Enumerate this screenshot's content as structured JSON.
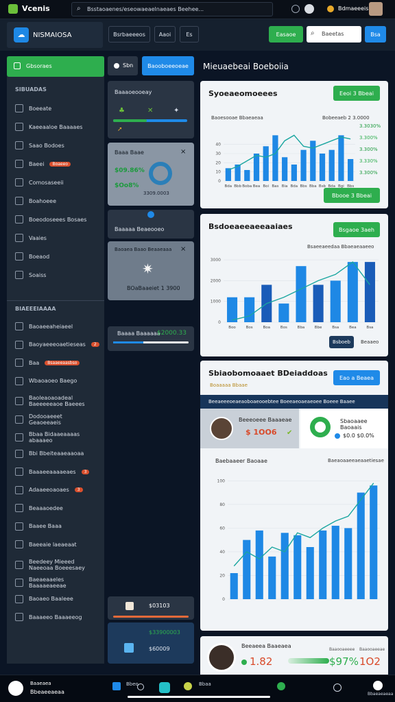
{
  "topbar": {
    "app_name": "Vcenis",
    "search_text": "Bsstaoaenes/eseowaeaelnaeaes Beehee...",
    "user_name": "Bdmaeeeis"
  },
  "navbar": {
    "brand": "NISMAIOSA",
    "btn1": "Bsrbaeeeos",
    "btn2": "Aaoi",
    "btn3": "Es",
    "green_btn": "Easaoe",
    "search_placeholder": "Baeetas",
    "blue_btn": "Bsa"
  },
  "sidebar": {
    "active_item": "Gbsoraes",
    "section1": "SIBUADAS",
    "items1": [
      {
        "icon": "list-icon",
        "label": "Boeeate"
      },
      {
        "icon": "folder-icon",
        "label": "Kaeeaaloe Baaaaes"
      },
      {
        "icon": "grid-icon",
        "label": "Saao Bodoes"
      },
      {
        "icon": "file-icon",
        "label": "Baeei",
        "badge": "Boaeeo"
      },
      {
        "icon": "box-icon",
        "label": "Comosaseeii"
      },
      {
        "icon": "pen-icon",
        "label": "Boahoeee"
      },
      {
        "icon": "gear-icon",
        "label": "Boeodoseees Bosaes"
      },
      {
        "icon": "window-icon",
        "label": "Vaaies"
      },
      {
        "icon": "doc-icon",
        "label": "Boeaod"
      },
      {
        "icon": "mail-icon",
        "label": "Soaiss"
      }
    ],
    "section2": "BIAEEEIAAAA",
    "items2": [
      {
        "icon": "people-icon",
        "label": "Baoaeeaheiaeel"
      },
      {
        "icon": "chart-icon",
        "label": "Baoyaeeeoaetieseas",
        "badge": "2"
      },
      {
        "icon": "cube-icon",
        "label": "Baa",
        "badge": "Bsaaeeaasbso"
      },
      {
        "icon": "clock-icon",
        "label": "Wbaoaoeo Baego"
      },
      {
        "icon": "globe-icon",
        "label": "Baoleaoaoadeal Baeeeeeaoe Baeees"
      },
      {
        "icon": "book-icon",
        "label": "Dodooaeeet Geaoeeaeis"
      },
      {
        "icon": "screen-icon",
        "label": "Bbaa Bidaaeaaaas abaaaeo"
      },
      {
        "icon": "image-icon",
        "label": "Bbi Bbeiteaaeaaoaa"
      },
      {
        "icon": "monitor-icon",
        "label": "Baaaeeaaaaeaes",
        "badge": "3"
      },
      {
        "icon": "chat-icon",
        "label": "Adaaeeoaoaes",
        "badge": "3"
      },
      {
        "icon": "star-icon",
        "label": "Beaaaoedee"
      },
      {
        "icon": "calendar-icon",
        "label": "Baaee Baaa"
      },
      {
        "icon": "edit-icon",
        "label": "Baeeaie laeaeaat"
      },
      {
        "icon": "user-icon",
        "label": "Beedeey Mieeed Naeeoaa Boeeesaey"
      },
      {
        "icon": "tool-icon",
        "label": "Baeaeaaeles Baaaaeaeeae"
      },
      {
        "icon": "paper-icon",
        "label": "Baoaeo Baaleee"
      },
      {
        "icon": "setting-icon",
        "label": "Baaaeeo Baaaeeog"
      }
    ]
  },
  "midcol": {
    "tab1": "Sbn",
    "tab2": "Baooboeeoeae",
    "panel1_title": "Baaaoeooeay",
    "panel2_title": "Baaa Baae",
    "panel2_v1": "$09.86%",
    "panel2_v2": "$Oo8%",
    "panel2_v3": "3309.0003",
    "panel3_text": "Baaaaa Beaeooeo",
    "panel4_title": "Baoaea Baao Beaaeaaa",
    "panel4_val": "BOaBaaeiet 1 3900",
    "panel5_label": "Baaaa Baaaaaa",
    "panel5_val": "$2000.33",
    "panel6_val": "$03103",
    "panel7_val": "$33900003",
    "panel7_val2": "$60009"
  },
  "main": {
    "title": "Mieuaebeai Boeboiia",
    "card1": {
      "title": "Syoeaeomoeees",
      "btn": "Eeoi 3 Bbeai",
      "footer_btn": "Bbooe 3 Bbeai",
      "legend_left": "Baoesooae Bbaeaeaa",
      "legend_right": "Bobeeaeb 2 3.0000",
      "side_vals": [
        "3.3030%",
        "3.300%",
        "3.300%",
        "3.330%",
        "3.300%"
      ]
    },
    "card2": {
      "title": "Bsdoeaeeaeeaaiaes",
      "btn": "Bsgaoe 3aeh",
      "legend": "Bsaeeaeedaa Bbaeaeaaeeo",
      "footer_btn": "Bsboeb",
      "footer_text": "Beaaeo"
    },
    "card3": {
      "title": "Sbiaobomoaaet BDeiaddoas",
      "sub": "Boaaaaa Bbaae",
      "btn": "Eao a Beaea",
      "banner": "Beeaeeeoeaeaoboaeooebtee Boeeaeoaeaeoee Boeee Baaee",
      "person_name": "Beeeoeee Baaaeae",
      "person_val": "$ 1OO6",
      "ring_title": "Sbaoaaee Baoaais",
      "ring_val": "$0.0 $0.0%",
      "chart_title": "Baebaaeer Baoaae",
      "chart_legend": "Baeaoaaeeaeaaetiesae"
    },
    "card4": {
      "person_name": "Beeaeea Baaeaea",
      "val1": "1.82",
      "val2": "$97%",
      "val3": "1O2",
      "small_labels": [
        "Bbeaeeaeeeaaee",
        "Baaooaeeee",
        "Baaooaeeae"
      ]
    }
  },
  "bottombar": {
    "left_label": "Baaeaea",
    "left_sub": "Bbeaeeaeaa",
    "items": [
      "Bbeo",
      "Bbaa",
      "Baaebaeaee",
      "Baaebaeaee",
      "Bbae"
    ],
    "right_label": "Bbaeaeaeaa"
  },
  "chart_data": [
    {
      "type": "bar",
      "title": "Syoeaeomoeees",
      "categories": [
        "Bda",
        "Bbb",
        "Boba",
        "Bea",
        "Boi",
        "Bas",
        "Bia",
        "Bda",
        "Bbs",
        "Bba",
        "Bsb",
        "Bda",
        "Bgi",
        "Bbs"
      ],
      "values": [
        14,
        18,
        12,
        30,
        38,
        50,
        26,
        18,
        34,
        44,
        30,
        34,
        50,
        24
      ],
      "line": [
        12,
        16,
        22,
        28,
        26,
        30,
        44,
        50,
        38,
        36,
        40,
        44,
        48,
        46
      ],
      "yticks": [
        0,
        10,
        20,
        30,
        40
      ],
      "ylim": [
        0,
        60
      ]
    },
    {
      "type": "bar",
      "title": "Bsdoeaeeaeeaaiaes",
      "categories": [
        "Boo",
        "Bos",
        "Boa",
        "Bos",
        "Bba",
        "Bbe",
        "Bsa",
        "Bea",
        "Bsa"
      ],
      "values": [
        1200,
        1200,
        1800,
        900,
        2700,
        1800,
        2000,
        2900,
        2900
      ],
      "line": [
        100,
        300,
        900,
        1200,
        1600,
        2000,
        2300,
        2900,
        1800
      ],
      "yticks": [
        0,
        1000,
        2000,
        3000
      ],
      "ylim": [
        0,
        3300
      ]
    },
    {
      "type": "bar",
      "title": "Baebaaeer Baoaae",
      "categories": [
        "Bbb",
        "Bbo",
        "Beb",
        "Bbe",
        "Bbb",
        "Bbe",
        "Bbb",
        "Bab",
        "Bbo",
        "Bbi",
        "Bbs",
        "Bab"
      ],
      "values": [
        22,
        50,
        58,
        36,
        56,
        54,
        44,
        58,
        62,
        60,
        90,
        96
      ],
      "line": [
        28,
        40,
        34,
        44,
        40,
        56,
        52,
        60,
        66,
        70,
        84,
        98
      ],
      "yticks": [
        0,
        20,
        40,
        60,
        80,
        100
      ],
      "ylim": [
        0,
        110
      ]
    }
  ],
  "colors": {
    "accent_green": "#2eae4e",
    "accent_blue": "#1f8ae8",
    "bar_blue": "#1e88e5",
    "line_teal": "#1aa6a0"
  }
}
